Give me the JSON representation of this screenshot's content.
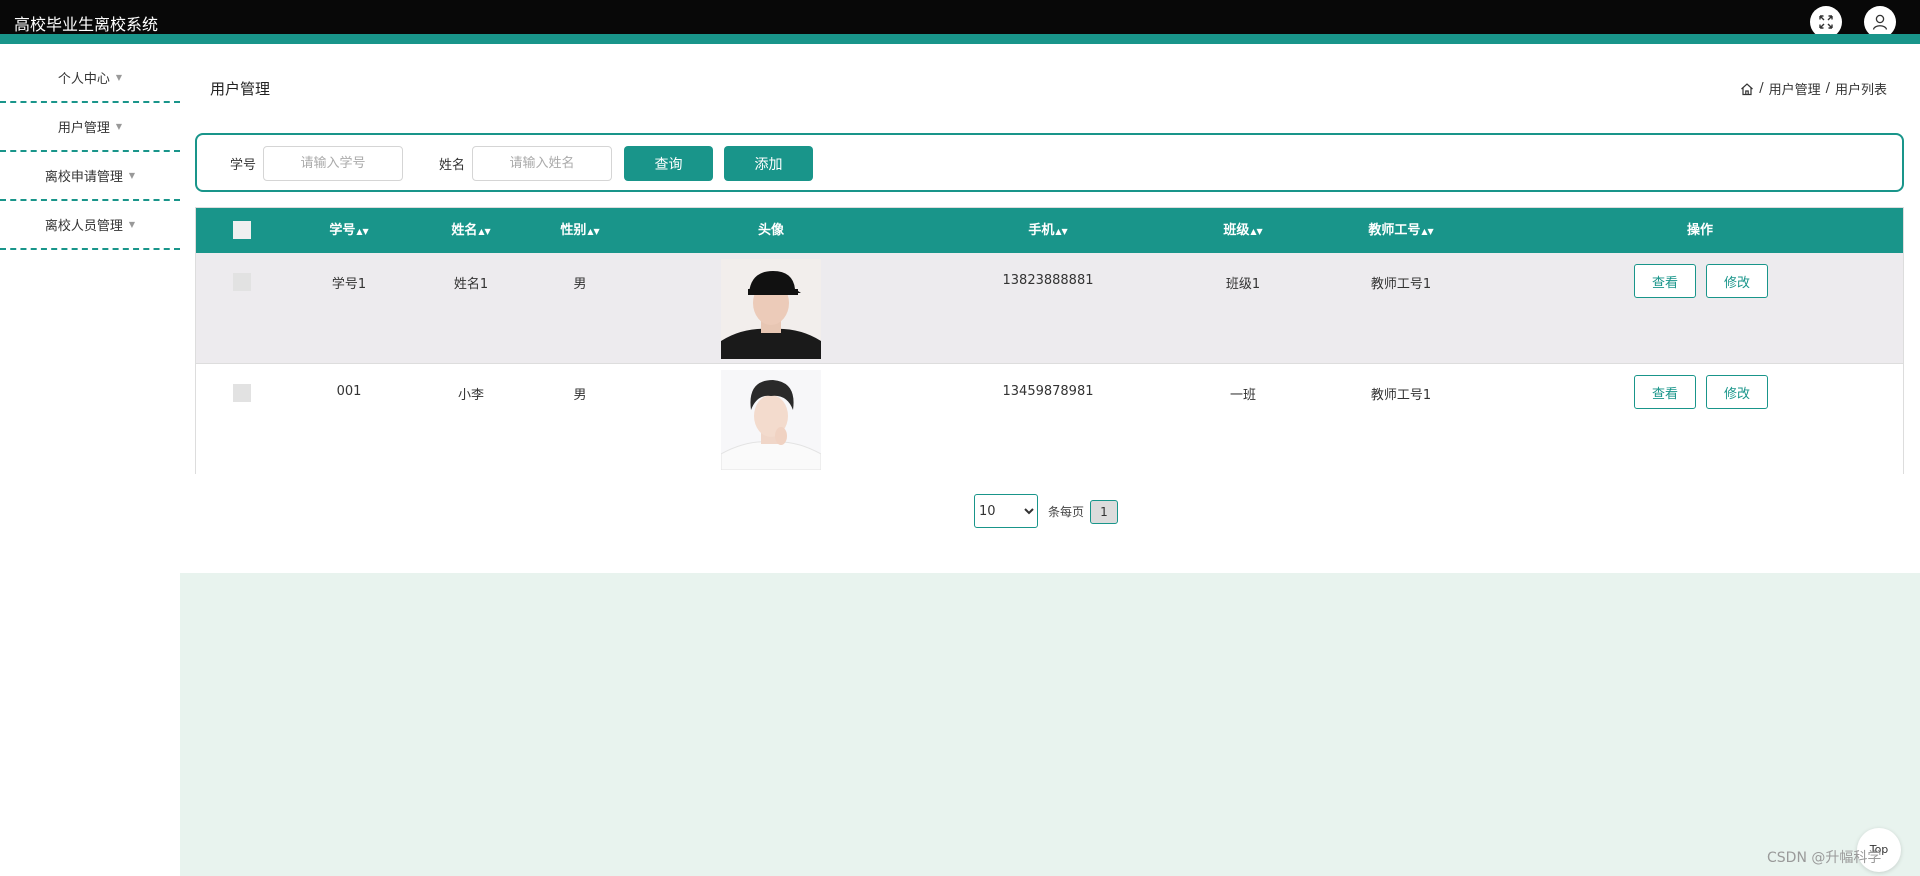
{
  "app": {
    "title": "高校毕业生离校系统"
  },
  "sidebar": {
    "items": [
      {
        "label": "个人中心"
      },
      {
        "label": "用户管理"
      },
      {
        "label": "离校申请管理"
      },
      {
        "label": "离校人员管理"
      }
    ]
  },
  "page": {
    "title": "用户管理",
    "breadcrumb": [
      "用户管理",
      "用户列表"
    ]
  },
  "search": {
    "student_id_label": "学号",
    "student_id_placeholder": "请输入学号",
    "name_label": "姓名",
    "name_placeholder": "请输入姓名",
    "query_button": "查询",
    "add_button": "添加"
  },
  "table": {
    "columns": [
      "学号",
      "姓名",
      "性别",
      "头像",
      "手机",
      "班级",
      "教师工号",
      "操作"
    ],
    "rows": [
      {
        "student_id": "学号1",
        "name": "姓名1",
        "gender": "男",
        "phone": "13823888881",
        "class": "班级1",
        "teacher_id": "教师工号1",
        "view": "查看",
        "edit": "修改"
      },
      {
        "student_id": "001",
        "name": "小李",
        "gender": "男",
        "phone": "13459878981",
        "class": "一班",
        "teacher_id": "教师工号1",
        "view": "查看",
        "edit": "修改"
      }
    ]
  },
  "pagination": {
    "page_size": "10",
    "per_page_label": "条每页",
    "current_page": "1"
  },
  "floating": {
    "to_top": "Top",
    "watermark": "CSDN @升幅科学"
  },
  "colors": {
    "accent": "#19958a",
    "topbar": "#080808",
    "content_bg": "#e8f3ee"
  }
}
